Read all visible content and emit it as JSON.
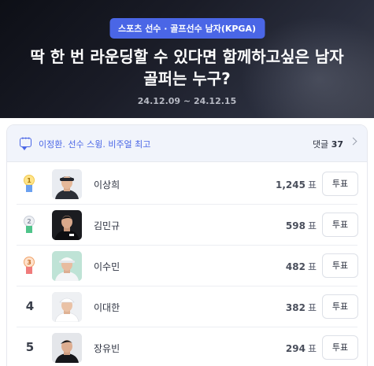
{
  "header": {
    "category": "스포츠 선수 · 골프선수 남자(KPGA)",
    "title": "딱 한 번 라운딩할 수 있다면 함께하고싶은 남자 골퍼는 누구?",
    "date_range": "24.12.09 ~ 24.12.15",
    "accent_color": "#4a66e6"
  },
  "comment_bar": {
    "icon": "comment-icon",
    "text": "이정환. 선수 스윙. 비주얼 최고",
    "count_label": "댓글",
    "count": "37"
  },
  "ranking": [
    {
      "rank": "1",
      "medal": "gold",
      "name": "이상희",
      "votes": "1,245",
      "unit": "표",
      "button": "투표",
      "photo": "avatar-dark-cap"
    },
    {
      "rank": "2",
      "medal": "silver",
      "name": "김민규",
      "votes": "598",
      "unit": "표",
      "button": "투표",
      "photo": "avatar-black-shirt"
    },
    {
      "rank": "3",
      "medal": "bronze",
      "name": "이수민",
      "votes": "482",
      "unit": "표",
      "button": "투표",
      "photo": "avatar-white-cap"
    },
    {
      "rank": "4",
      "medal": "",
      "name": "이대한",
      "votes": "382",
      "unit": "표",
      "button": "투표",
      "photo": "avatar-white-shirt"
    },
    {
      "rank": "5",
      "medal": "",
      "name": "장유빈",
      "votes": "294",
      "unit": "표",
      "button": "투표",
      "photo": "avatar-dark-shirt"
    }
  ]
}
